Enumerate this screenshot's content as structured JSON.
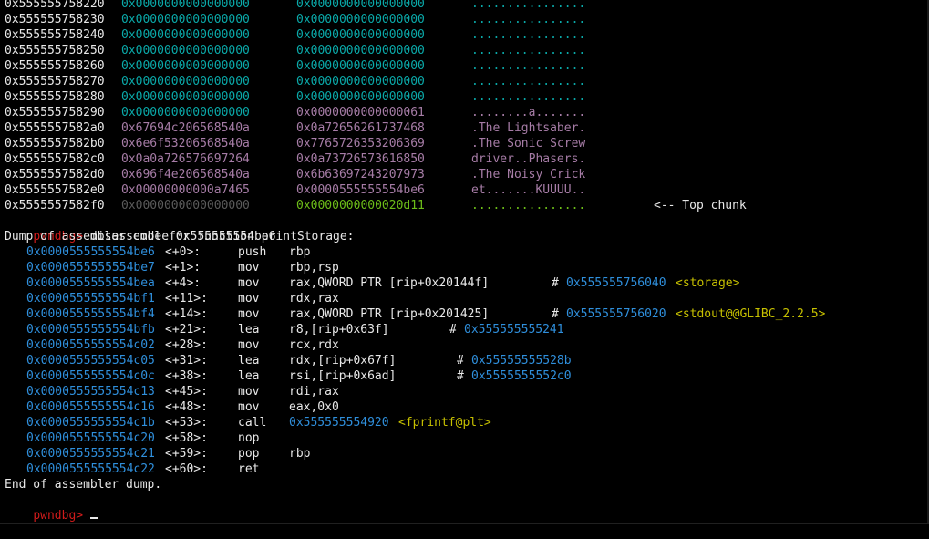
{
  "heap_rows": [
    {
      "addr": "0x555555758220",
      "v1": "0x0000000000000000",
      "v2": "0x0000000000000000",
      "ascii": "................",
      "c1": "cyan",
      "c2": "cyan",
      "c3": "cyan",
      "note": ""
    },
    {
      "addr": "0x555555758230",
      "v1": "0x0000000000000000",
      "v2": "0x0000000000000000",
      "ascii": "................",
      "c1": "cyan",
      "c2": "cyan",
      "c3": "cyan",
      "note": ""
    },
    {
      "addr": "0x555555758240",
      "v1": "0x0000000000000000",
      "v2": "0x0000000000000000",
      "ascii": "................",
      "c1": "cyan",
      "c2": "cyan",
      "c3": "cyan",
      "note": ""
    },
    {
      "addr": "0x555555758250",
      "v1": "0x0000000000000000",
      "v2": "0x0000000000000000",
      "ascii": "................",
      "c1": "cyan",
      "c2": "cyan",
      "c3": "cyan",
      "note": ""
    },
    {
      "addr": "0x555555758260",
      "v1": "0x0000000000000000",
      "v2": "0x0000000000000000",
      "ascii": "................",
      "c1": "cyan",
      "c2": "cyan",
      "c3": "cyan",
      "note": ""
    },
    {
      "addr": "0x555555758270",
      "v1": "0x0000000000000000",
      "v2": "0x0000000000000000",
      "ascii": "................",
      "c1": "cyan",
      "c2": "cyan",
      "c3": "cyan",
      "note": ""
    },
    {
      "addr": "0x555555758280",
      "v1": "0x0000000000000000",
      "v2": "0x0000000000000000",
      "ascii": "................",
      "c1": "cyan",
      "c2": "cyan",
      "c3": "cyan",
      "note": ""
    },
    {
      "addr": "0x555555758290",
      "v1": "0x0000000000000000",
      "v2": "0x0000000000000061",
      "ascii": "........a.......",
      "c1": "cyan",
      "c2": "purple",
      "c3": "purple",
      "note": ""
    },
    {
      "addr": "0x5555557582a0",
      "v1": "0x67694c206568540a",
      "v2": "0x0a72656261737468",
      "ascii": ".The Lightsaber.",
      "c1": "purple",
      "c2": "purple",
      "c3": "purple",
      "note": ""
    },
    {
      "addr": "0x5555557582b0",
      "v1": "0x6e6f53206568540a",
      "v2": "0x7765726353206369",
      "ascii": ".The Sonic Screw",
      "c1": "purple",
      "c2": "purple",
      "c3": "purple",
      "note": ""
    },
    {
      "addr": "0x5555557582c0",
      "v1": "0x0a0a726576697264",
      "v2": "0x0a73726573616850",
      "ascii": "driver..Phasers.",
      "c1": "purple",
      "c2": "purple",
      "c3": "purple",
      "note": ""
    },
    {
      "addr": "0x5555557582d0",
      "v1": "0x696f4e206568540a",
      "v2": "0x6b63697243207973",
      "ascii": ".The Noisy Crick",
      "c1": "purple",
      "c2": "purple",
      "c3": "purple",
      "note": ""
    },
    {
      "addr": "0x5555557582e0",
      "v1": "0x00000000000a7465",
      "v2": "0x0000555555554be6",
      "ascii": "et.......KUUUU..",
      "c1": "purple",
      "c2": "purple",
      "c3": "purple",
      "note": ""
    },
    {
      "addr": "0x5555557582f0",
      "v1": "0x0000000000000000",
      "v2": "0x0000000000020d11",
      "ascii": "................",
      "c1": "dim",
      "c2": "green",
      "c3": "green",
      "note": "<-- Top chunk"
    }
  ],
  "prompt": "pwndbg>",
  "command": " disassemble 0x555555554be6",
  "dump_header": "Dump of assembler code for function printStorage:",
  "asm": [
    {
      "addr": "0x0000555555554be6",
      "off": "<+0>:",
      "mn": "push",
      "ops": "rbp",
      "cmt": "",
      "cval": "",
      "csym": ""
    },
    {
      "addr": "0x0000555555554be7",
      "off": "<+1>:",
      "mn": "mov",
      "ops": "rbp,rsp",
      "cmt": "",
      "cval": "",
      "csym": ""
    },
    {
      "addr": "0x0000555555554bea",
      "off": "<+4>:",
      "mn": "mov",
      "ops": "rax,QWORD PTR [rip+0x20144f]",
      "cmt": "#",
      "cval": "0x555555756040",
      "csym": "<storage>"
    },
    {
      "addr": "0x0000555555554bf1",
      "off": "<+11>:",
      "mn": "mov",
      "ops": "rdx,rax",
      "cmt": "",
      "cval": "",
      "csym": ""
    },
    {
      "addr": "0x0000555555554bf4",
      "off": "<+14>:",
      "mn": "mov",
      "ops": "rax,QWORD PTR [rip+0x201425]",
      "cmt": "#",
      "cval": "0x555555756020",
      "csym": "<stdout@@GLIBC_2.2.5>"
    },
    {
      "addr": "0x0000555555554bfb",
      "off": "<+21>:",
      "mn": "lea",
      "ops": "r8,[rip+0x63f]",
      "cmt": "#",
      "cval": "0x555555555241",
      "csym": ""
    },
    {
      "addr": "0x0000555555554c02",
      "off": "<+28>:",
      "mn": "mov",
      "ops": "rcx,rdx",
      "cmt": "",
      "cval": "",
      "csym": ""
    },
    {
      "addr": "0x0000555555554c05",
      "off": "<+31>:",
      "mn": "lea",
      "ops": "rdx,[rip+0x67f]",
      "cmt": "#",
      "cval": "0x55555555528b",
      "csym": ""
    },
    {
      "addr": "0x0000555555554c0c",
      "off": "<+38>:",
      "mn": "lea",
      "ops": "rsi,[rip+0x6ad]",
      "cmt": "#",
      "cval": "0x5555555552c0",
      "csym": ""
    },
    {
      "addr": "0x0000555555554c13",
      "off": "<+45>:",
      "mn": "mov",
      "ops": "rdi,rax",
      "cmt": "",
      "cval": "",
      "csym": ""
    },
    {
      "addr": "0x0000555555554c16",
      "off": "<+48>:",
      "mn": "mov",
      "ops": "eax,0x0",
      "cmt": "",
      "cval": "",
      "csym": ""
    },
    {
      "addr": "0x0000555555554c1b",
      "off": "<+53>:",
      "mn": "call",
      "ops": "",
      "cmt": "",
      "cval": "0x555555554920",
      "csym": "<fprintf@plt>"
    },
    {
      "addr": "0x0000555555554c20",
      "off": "<+58>:",
      "mn": "nop",
      "ops": "",
      "cmt": "",
      "cval": "",
      "csym": ""
    },
    {
      "addr": "0x0000555555554c21",
      "off": "<+59>:",
      "mn": "pop",
      "ops": "rbp",
      "cmt": "",
      "cval": "",
      "csym": ""
    },
    {
      "addr": "0x0000555555554c22",
      "off": "<+60>:",
      "mn": "ret",
      "ops": "",
      "cmt": "",
      "cval": "",
      "csym": ""
    }
  ],
  "dump_footer": "End of assembler dump.",
  "colors": {
    "cyan": "#0aa8a8",
    "purple": "#a67ca6",
    "green": "#6cbd18",
    "red": "#d01b1b",
    "blue": "#2f8fdc",
    "yellow": "#c7c100"
  }
}
